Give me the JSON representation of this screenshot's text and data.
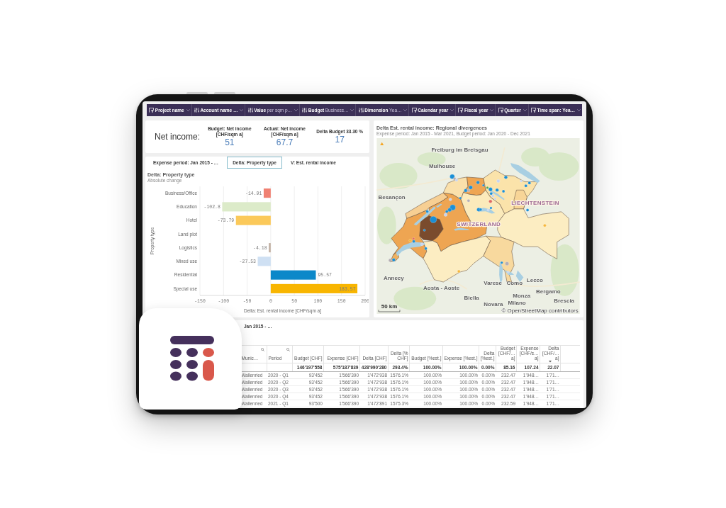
{
  "filters": [
    {
      "kind": "field",
      "label": "Project name"
    },
    {
      "kind": "variable",
      "label": "Account name …"
    },
    {
      "kind": "variable",
      "label": "Value",
      "value": "per sqm p…"
    },
    {
      "kind": "variable",
      "label": "Budget",
      "value": "Business…"
    },
    {
      "kind": "variable",
      "label": "Dimension",
      "value": "Yea…"
    },
    {
      "kind": "field",
      "label": "Calendar year"
    },
    {
      "kind": "field",
      "label": "Fiscal year"
    },
    {
      "kind": "field",
      "label": "Quarter"
    },
    {
      "kind": "field",
      "label": "Time span: Yea…"
    }
  ],
  "kpi_card": {
    "title": "Net income:",
    "kpis": [
      {
        "label": "Budget: Net income [CHF/sqm a]",
        "value": "51"
      },
      {
        "label": "Actual: Net income [CHF/sqm a]",
        "value": "67.7"
      },
      {
        "label": "Delta Budget 33.30 %",
        "value": "17"
      }
    ]
  },
  "map_panel": {
    "title": "Delta Est. rental income: Regional divergences",
    "subtitle": "Expense period: Jan 2015 - Mar 2021, Budget period: Jan 2020 - Dec 2021",
    "places": [
      {
        "kind": "city",
        "label": "Freiburg im Breisgau"
      },
      {
        "kind": "city",
        "label": "Mulhouse"
      },
      {
        "kind": "city",
        "label": "Besançon"
      },
      {
        "kind": "country",
        "label": "LIECHTENSTEIN"
      },
      {
        "kind": "country",
        "label": "SWITZERLAND"
      },
      {
        "kind": "city",
        "label": "Annecy"
      },
      {
        "kind": "city",
        "label": "Aosta - Aoste"
      },
      {
        "kind": "city",
        "label": "Varese"
      },
      {
        "kind": "city",
        "label": "Como"
      },
      {
        "kind": "city",
        "label": "Lecco"
      },
      {
        "kind": "city",
        "label": "Bergamo"
      },
      {
        "kind": "city",
        "label": "Monza"
      },
      {
        "kind": "city",
        "label": "Brescia"
      },
      {
        "kind": "city",
        "label": "Biella"
      },
      {
        "kind": "city",
        "label": "Novara"
      },
      {
        "kind": "city",
        "label": "Milano"
      }
    ],
    "scale_label": "50 km",
    "attribution": "© OpenStreetMap contributors"
  },
  "chart_panel": {
    "tabs": [
      {
        "label": "Expense period: Jan 2015 - …",
        "selected": false
      },
      {
        "label": "Delta: Property type",
        "selected": true
      },
      {
        "label": "V: Est. rental income",
        "selected": false
      }
    ],
    "subtitle": "Absolute change",
    "chart_data": {
      "type": "bar",
      "orientation": "horizontal",
      "title": "Delta: Property type",
      "xlabel": "Delta: Est. rental income [CHF/sqm a]",
      "ylabel": "Property type",
      "categories": [
        "Business/Office",
        "Education",
        "Hotel",
        "Land plot",
        "Logistics",
        "Mixed use",
        "Residential",
        "Special use"
      ],
      "values": [
        -14.91,
        -102.8,
        -73.79,
        null,
        -4.18,
        -27.53,
        95.57,
        183.57
      ],
      "colors": [
        "#f08172",
        "#dcebc9",
        "#fbc95a",
        null,
        "#c4b3a6",
        "#cfe0f3",
        "#0c88c9",
        "#f8b500"
      ],
      "xlim": [
        -150,
        200
      ],
      "xticks": [
        -150,
        -100,
        -50,
        0,
        50,
        100,
        150,
        200
      ],
      "grid": true,
      "data_labels": true
    }
  },
  "table_panel": {
    "title": "Jan 2015 - …",
    "columns": [
      {
        "kind": "name",
        "label": "Munic…",
        "searchable": true,
        "sorted": false
      },
      {
        "kind": "period",
        "label": "Period",
        "searchable": true,
        "sorted": false
      },
      {
        "kind": "measure",
        "label": "Budget [CHF]",
        "searchable": false,
        "sorted": false,
        "total": "146'197'558"
      },
      {
        "kind": "measure",
        "label": "Expense [CHF]",
        "searchable": false,
        "sorted": false,
        "total": "575'187'839"
      },
      {
        "kind": "measure",
        "label": "Delta [CHF]",
        "searchable": false,
        "sorted": false,
        "total": "428'990'280"
      },
      {
        "kind": "measure",
        "label": "Delta [% CHF]",
        "searchable": false,
        "sorted": false,
        "total": "293.4%"
      },
      {
        "kind": "measure",
        "label": "Budget [%est.]",
        "searchable": false,
        "sorted": false,
        "total": "100.00%"
      },
      {
        "kind": "measure",
        "label": "Expense [%est.]",
        "searchable": false,
        "sorted": false,
        "total": "100.00%"
      },
      {
        "kind": "measure",
        "label": "Delta [%est.]",
        "searchable": false,
        "sorted": false,
        "total": "0.00%"
      },
      {
        "kind": "measure",
        "label": "Budget [CHF/… a]",
        "searchable": false,
        "sorted": false,
        "total": "85.16"
      },
      {
        "kind": "measure",
        "label": "Expense [CHF/s… a]",
        "searchable": false,
        "sorted": false,
        "total": "107.24"
      },
      {
        "kind": "measure",
        "label": "Delta [CHF/… a]",
        "searchable": false,
        "sorted": true,
        "total": "22.07"
      }
    ],
    "rows": [
      [
        "Wallenried",
        "2020 - Q1",
        "93'452",
        "1'566'390",
        "1'472'938",
        "1576.1%",
        "100.00%",
        "100.00%",
        "0.00%",
        "232.47",
        "1'948…",
        "1'71…"
      ],
      [
        "Wallenried",
        "2020 - Q2",
        "93'452",
        "1'566'390",
        "1'472'938",
        "1576.1%",
        "100.00%",
        "100.00%",
        "0.00%",
        "232.47",
        "1'948…",
        "1'71…"
      ],
      [
        "Wallenried",
        "2020 - Q3",
        "93'452",
        "1'566'390",
        "1'472'938",
        "1576.1%",
        "100.00%",
        "100.00%",
        "0.00%",
        "232.47",
        "1'948…",
        "1'71…"
      ],
      [
        "Wallenried",
        "2020 - Q4",
        "93'452",
        "1'566'390",
        "1'472'938",
        "1576.1%",
        "100.00%",
        "100.00%",
        "0.00%",
        "232.47",
        "1'948…",
        "1'71…"
      ],
      [
        "Wallenried",
        "2021 - Q1",
        "93'500",
        "1'566'390",
        "1'472'891",
        "1575.3%",
        "100.00%",
        "100.00%",
        "0.00%",
        "232.59",
        "1'948…",
        "1'71…"
      ]
    ]
  }
}
